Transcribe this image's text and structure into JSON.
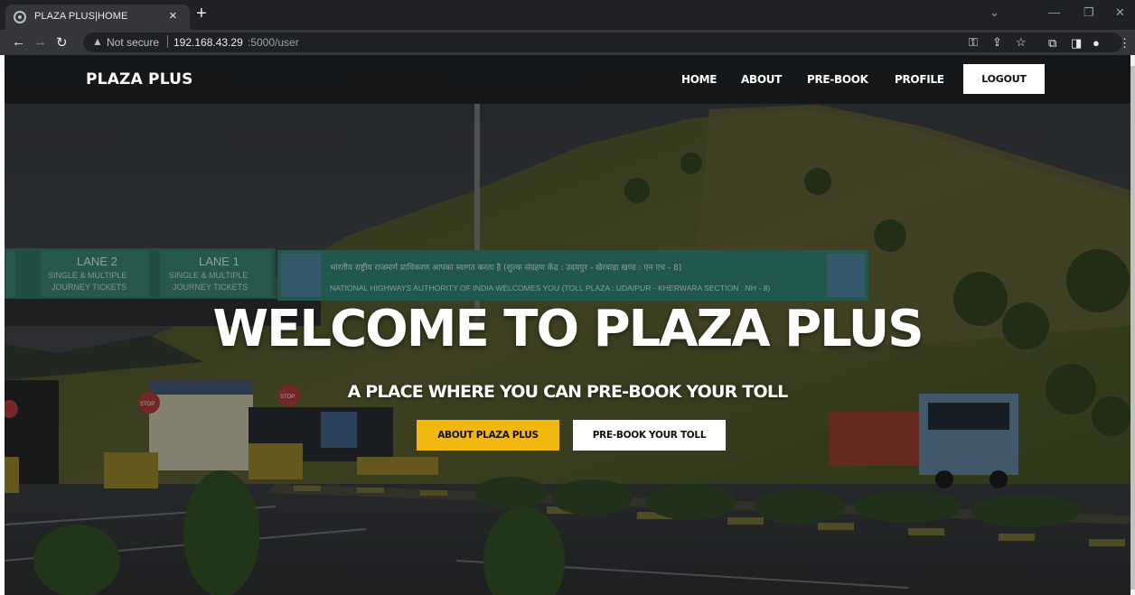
{
  "browser": {
    "tab_title": "PLAZA PLUS|HOME",
    "not_secure_label": "Not secure",
    "url_host": "192.168.43.29",
    "url_rest": ":5000/user"
  },
  "navbar": {
    "brand": "PLAZA PLUS",
    "links": [
      "HOME",
      "ABOUT",
      "PRE-BOOK",
      "PROFILE"
    ],
    "logout_label": "LOGOUT"
  },
  "hero": {
    "title": "WELCOME TO PLAZA PLUS",
    "subtitle": "A PLACE WHERE YOU CAN PRE-BOOK YOUR TOLL",
    "about_button": "ABOUT PLAZA PLUS",
    "prebook_button": "PRE-BOOK YOUR TOLL"
  },
  "background_photo": {
    "lane2_title": "LANE 2",
    "lane1_title": "LANE 1",
    "lane_line1": "SINGLE & MULTIPLE",
    "lane_line2": "JOURNEY TICKETS",
    "gantry_hindi": "भारतीय राष्ट्रीय राजमार्ग प्राधिकरण आपका स्वागत करता है (शुल्क संग्रहण केंद्र : उदयपुर - खेरवाड़ा खण्ड : एन एच - 8)",
    "gantry_english": "NATIONAL HIGHWAYS AUTHORITY OF INDIA WELCOMES YOU (TOLL PLAZA : UDAIPUR - KHERWARA SECTION : NH - 8)",
    "stop_sign": "STOP"
  },
  "colors": {
    "accent_yellow": "#f3b80f",
    "navbar_bg": "#141618",
    "chrome_bg": "#202124",
    "gantry_green": "#2e7a6b"
  },
  "icons": [
    "globe-icon",
    "close-icon",
    "plus-icon",
    "back-icon",
    "forward-icon",
    "reload-icon",
    "warning-icon",
    "key-icon",
    "share-icon",
    "star-icon",
    "extensions-icon",
    "sidepanel-icon",
    "profile-icon",
    "menu-icon",
    "minimize-icon",
    "restore-icon",
    "window-close-icon",
    "chevron-down-icon"
  ]
}
